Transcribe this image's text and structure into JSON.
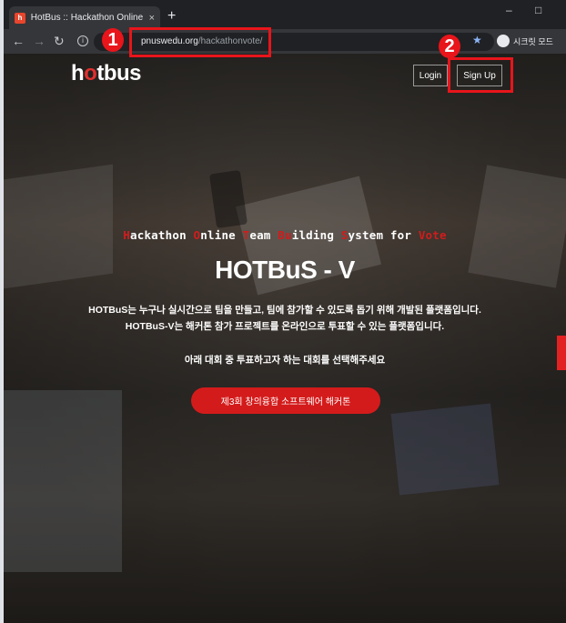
{
  "browser": {
    "tab_title": "HotBus :: Hackathon Online Vot",
    "tab_close": "×",
    "new_tab": "+",
    "favicon_letter": "h",
    "url_host": "pnuswedu.org",
    "url_path": "/hackathonvote/",
    "profile_label": "시크릿 모드",
    "icons": [
      "back-arrow-icon",
      "forward-arrow-icon",
      "reload-icon",
      "info-icon",
      "star-icon",
      "profile-icon"
    ],
    "win_controls": {
      "minimize": "–",
      "maximize": "□"
    }
  },
  "header": {
    "logo_left": "h",
    "logo_o": "o",
    "logo_right": "tbus",
    "login_label": "Login",
    "signup_label": "Sign Up"
  },
  "hero": {
    "subtitle_parts": [
      {
        "r": "H",
        "w": "ackathon "
      },
      {
        "r": "O",
        "w": "nline "
      },
      {
        "r": "T",
        "w": "eam "
      },
      {
        "r": "Bu",
        "w": "ilding "
      },
      {
        "r": "S",
        "w": "ystem for "
      },
      {
        "r": "Vote",
        "w": ""
      }
    ],
    "title": "HOTBuS - V",
    "desc_line1": "HOTBuS는 누구나 실시간으로 팀을 만들고, 팀에 참가할 수 있도록 돕기 위해 개발된 플랫폼입니다.",
    "desc_line2": "HOTBuS-V는 해커톤 참가 프로젝트를 온라인으로 투표할 수 있는 플랫폼입니다.",
    "desc_line3": "아래 대회 중 투표하고자 하는 대회를 선택해주세요",
    "contest_button": "제3회 창의융합 소프트웨어 해커톤"
  },
  "annotations": {
    "badge_1": "1",
    "badge_2": "2",
    "color": "#e8151b"
  },
  "colors": {
    "accent_red": "#d41b1b",
    "browser_dark": "#202124",
    "toolbar": "#35363a"
  }
}
